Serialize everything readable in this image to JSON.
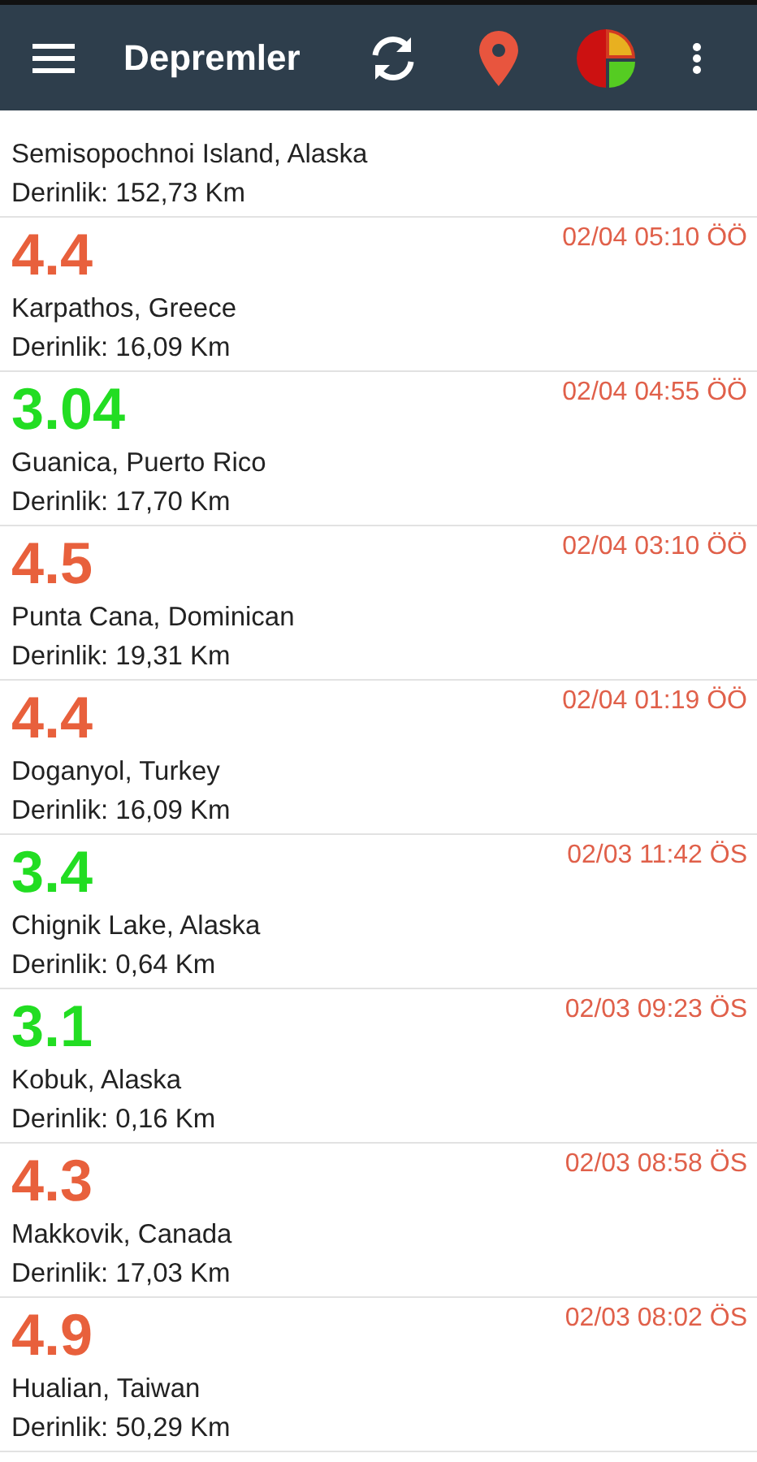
{
  "app_bar": {
    "title": "Depremler"
  },
  "quakes": [
    {
      "place": "Semisopochnoi Island, Alaska",
      "depth": "Derinlik: 152,73 Km"
    },
    {
      "magnitude": "4.4",
      "color": "#e8603c",
      "time": "02/04 05:10 ÖÖ",
      "place": "Karpathos, Greece",
      "depth": "Derinlik: 16,09 Km"
    },
    {
      "magnitude": "3.04",
      "color": "#22dd22",
      "time": "02/04 04:55 ÖÖ",
      "place": "Guanica, Puerto Rico",
      "depth": "Derinlik: 17,70 Km"
    },
    {
      "magnitude": "4.5",
      "color": "#e8603c",
      "time": "02/04 03:10 ÖÖ",
      "place": "Punta Cana, Dominican",
      "depth": "Derinlik: 19,31 Km"
    },
    {
      "magnitude": "4.4",
      "color": "#e8603c",
      "time": "02/04 01:19 ÖÖ",
      "place": "Doganyol, Turkey",
      "depth": "Derinlik: 16,09 Km"
    },
    {
      "magnitude": "3.4",
      "color": "#22dd22",
      "time": "02/03 11:42 ÖS",
      "place": "Chignik Lake, Alaska",
      "depth": "Derinlik: 0,64 Km"
    },
    {
      "magnitude": "3.1",
      "color": "#22dd22",
      "time": "02/03 09:23 ÖS",
      "place": "Kobuk, Alaska",
      "depth": "Derinlik: 0,16 Km"
    },
    {
      "magnitude": "4.3",
      "color": "#e8603c",
      "time": "02/03 08:58 ÖS",
      "place": "Makkovik, Canada",
      "depth": "Derinlik: 17,03 Km"
    },
    {
      "magnitude": "4.9",
      "color": "#e8603c",
      "time": "02/03 08:02 ÖS",
      "place": "Hualian, Taiwan",
      "depth": "Derinlik: 50,29 Km"
    }
  ]
}
